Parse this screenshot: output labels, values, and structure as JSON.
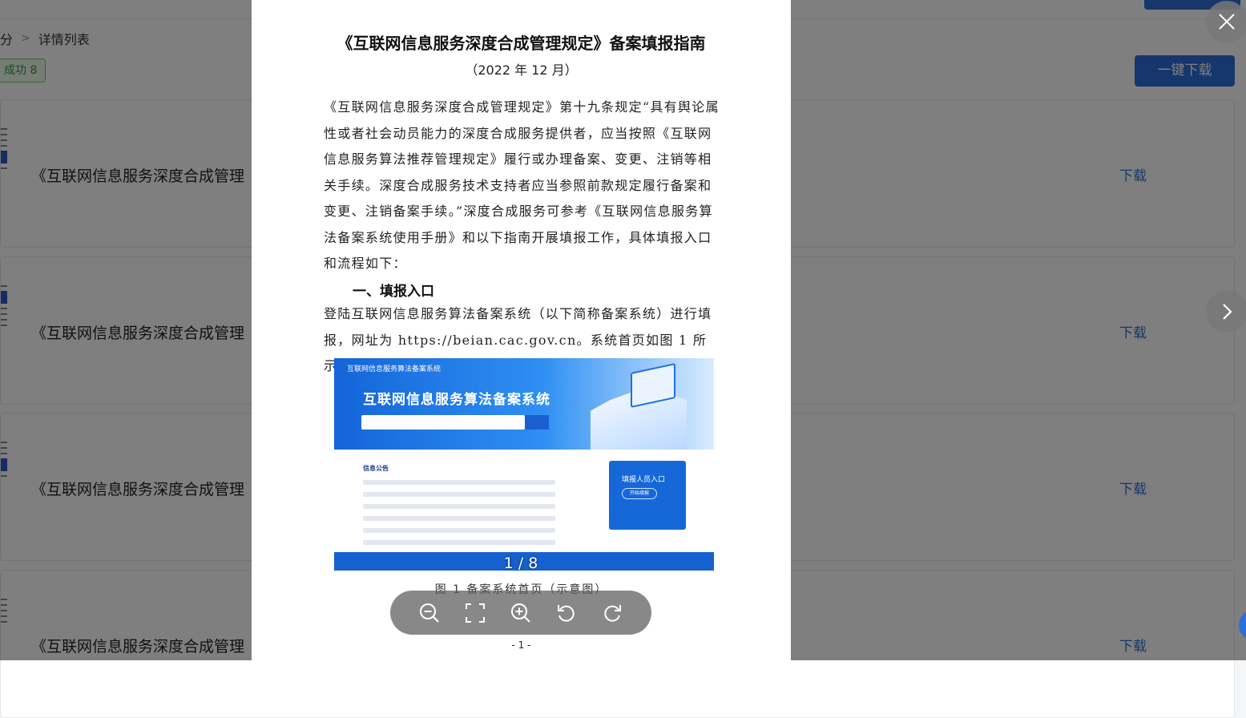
{
  "background": {
    "breadcrumb": {
      "first": "分",
      "second": "详情列表"
    },
    "status_tag": "成功 8",
    "download_all_label": "一键下载",
    "rows": [
      {
        "title": "《互联网信息服务深度合成管理",
        "download_label": "下载"
      },
      {
        "title": "《互联网信息服务深度合成管理",
        "download_label": "下载"
      },
      {
        "title": "《互联网信息服务深度合成管理",
        "download_label": "下载"
      },
      {
        "title": "《互联网信息服务深度合成管理",
        "download_label": "下载"
      }
    ],
    "accent_color": "#2d6fd6"
  },
  "viewer": {
    "counter": "1 / 8",
    "document": {
      "title": "《互联网信息服务深度合成管理规定》备案填报指南",
      "date": "（2022 年 12 月）",
      "paragraph1": "《互联网信息服务深度合成管理规定》第十九条规定“具有舆论属性或者社会动员能力的深度合成服务提供者，应当按照《互联网信息服务算法推荐管理规定》履行或办理备案、变更、注销等相关手续。深度合成服务技术支持者应当参照前款规定履行备案和变更、注销备案手续。”深度合成服务可参考《互联网信息服务算法备案系统使用手册》和以下指南开展填报工作，具体填报入口和流程如下：",
      "heading1": "一、填报入口",
      "paragraph2": "登陆互联网信息服务算法备案系统（以下简称备案系统）进行填报，网址为 https://beian.cac.gov.cn。系统首页如图 1 所示。",
      "figure": {
        "small_title": "互联网信息服务算法备案系统",
        "big_title": "互联网信息服务算法备案系统",
        "news_title": "信息公告",
        "card_title": "填报人员入口",
        "card_button": "开始填报"
      },
      "caption": "图 1 备案系统首页（示意图）",
      "page_number": "- 1 -"
    },
    "toolbar": [
      "zoom-out",
      "fit-screen",
      "zoom-in",
      "rotate-left",
      "rotate-right"
    ]
  }
}
